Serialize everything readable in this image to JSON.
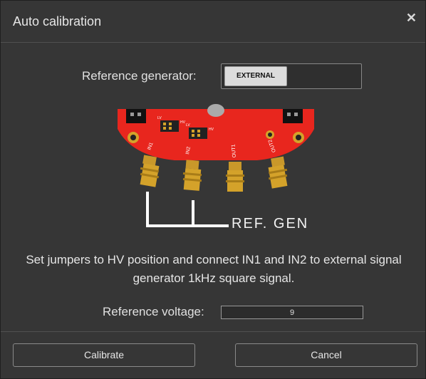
{
  "dialog": {
    "title": "Auto calibration",
    "close_icon": "close-icon"
  },
  "reference": {
    "label": "Reference generator:",
    "toggle_value": "EXTERNAL"
  },
  "figure": {
    "ref_gen_label": "REF. GEN",
    "ports": [
      "IN1",
      "IN2",
      "OUT1",
      "OUT2"
    ],
    "jumper_labels": [
      "LV",
      "HV",
      "LV",
      "HV"
    ]
  },
  "instructions": "Set jumpers to HV position and connect IN1 and IN2 to external signal generator 1kHz square signal.",
  "voltage": {
    "label": "Reference voltage:",
    "value": "9"
  },
  "buttons": {
    "calibrate": "Calibrate",
    "cancel": "Cancel"
  },
  "colors": {
    "board_red": "#e8261e",
    "connector_gold": "#d4a22a",
    "accent_white": "#ffffff"
  }
}
